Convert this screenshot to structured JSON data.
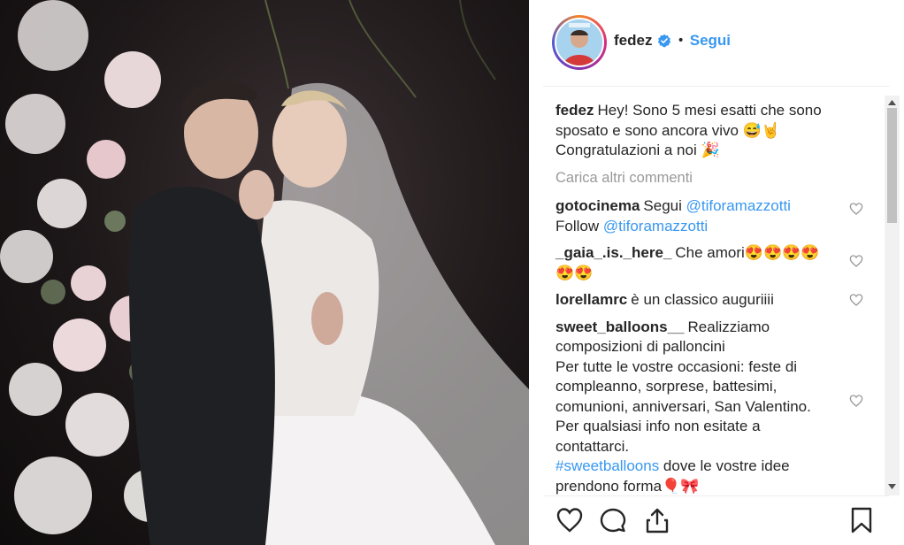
{
  "post": {
    "username": "fedez",
    "dot": "•",
    "follow_label": "Segui"
  },
  "caption": {
    "user": "fedez",
    "text": "Hey! Sono 5 mesi esatti che sono sposato e sono ancora vivo 😅🤘 Congratulazioni a noi 🎉"
  },
  "load_more_label": "Carica altri commenti",
  "comments": [
    {
      "user": "gotocinema",
      "text": "Segui @tiforamazzotti\nFollow @tiforamazzotti"
    },
    {
      "user": "_gaia_.is._here_",
      "text": "Che amori😍😍😍😍\n😍😍"
    },
    {
      "user": "lorellamrc",
      "text": "è un classico auguriiii"
    },
    {
      "user": "sweet_balloons__",
      "text": "Realizziamo composizioni di palloncini\nPer tutte le vostre occasioni: feste di compleanno, sorprese, battesimi, comunioni, anniversari, San Valentino.\nPer qualsiasi info non esitate a contattarci.\n#sweetballoons dove le vostre idee prendono forma🎈🎀"
    }
  ],
  "icons": {
    "verified": "verified-badge-icon",
    "like": "heart-icon",
    "comment": "comment-bubble-icon",
    "share": "share-icon",
    "save": "bookmark-icon"
  },
  "colors": {
    "link": "#3897f0",
    "verified": "#3897f0",
    "muted": "#999999",
    "text": "#262626"
  }
}
